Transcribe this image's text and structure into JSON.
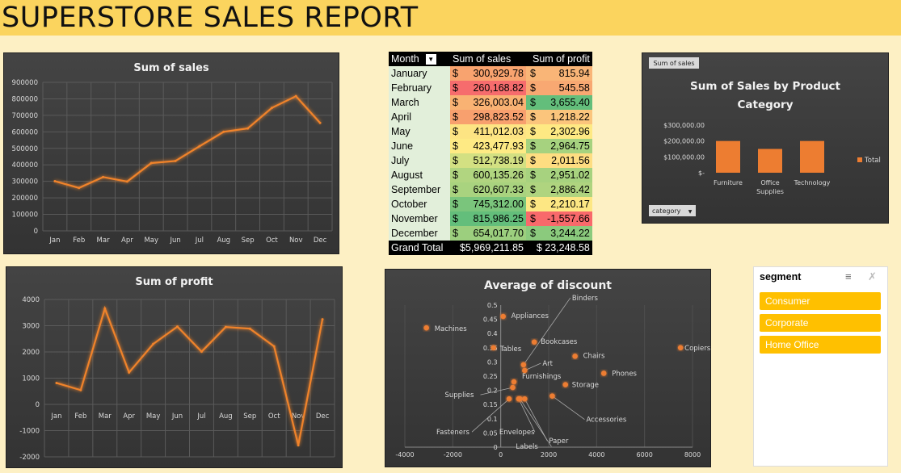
{
  "report_title": "SUPERSTORE SALES REPORT",
  "pivot": {
    "headers": [
      "Month",
      "Sum of sales",
      "Sum of profit"
    ],
    "rows": [
      {
        "month": "January",
        "sales": "300,929.78",
        "profit": "815.94",
        "sales_color": "#f8a36f",
        "profit_color": "#f9b577"
      },
      {
        "month": "February",
        "sales": "260,168.82",
        "profit": "545.58",
        "sales_color": "#f66c6d",
        "profit_color": "#f8a872"
      },
      {
        "month": "March",
        "sales": "326,003.04",
        "profit": "3,655.40",
        "sales_color": "#f9b273",
        "profit_color": "#63be7b"
      },
      {
        "month": "April",
        "sales": "298,823.52",
        "profit": "1,218.22",
        "sales_color": "#f8a06e",
        "profit_color": "#fbc57c"
      },
      {
        "month": "May",
        "sales": "411,012.03",
        "profit": "2,302.96",
        "sales_color": "#fde483",
        "profit_color": "#fee983"
      },
      {
        "month": "June",
        "sales": "423,477.93",
        "profit": "2,964.75",
        "sales_color": "#feea84",
        "profit_color": "#a6d27f"
      },
      {
        "month": "July",
        "sales": "512,738.19",
        "profit": "2,011.56",
        "sales_color": "#d3e082",
        "profit_color": "#fedd81"
      },
      {
        "month": "August",
        "sales": "600,135.26",
        "profit": "2,951.02",
        "sales_color": "#b1d580",
        "profit_color": "#a7d27f"
      },
      {
        "month": "September",
        "sales": "620,607.33",
        "profit": "2,886.42",
        "sales_color": "#a9d37f",
        "profit_color": "#afd47f"
      },
      {
        "month": "October",
        "sales": "745,312.00",
        "profit": "2,210.17",
        "sales_color": "#7ac57c",
        "profit_color": "#fde783"
      },
      {
        "month": "November",
        "sales": "815,986.25",
        "profit": "-1,557.66",
        "sales_color": "#63be7b",
        "profit_color": "#f8696b"
      },
      {
        "month": "December",
        "sales": "654,017.70",
        "profit": "3,244.22",
        "sales_color": "#9ccf7e",
        "profit_color": "#8bca7d"
      }
    ],
    "grand_total": {
      "label": "Grand Total",
      "sales": "$5,969,211.85",
      "profit": "$ 23,248.58"
    },
    "currency": "$"
  },
  "slicer": {
    "title": "segment",
    "items": [
      "Consumer",
      "Corporate",
      "Home Office"
    ],
    "accent": "#ffc000"
  },
  "chart_data": [
    {
      "type": "line",
      "title": "Sum of sales",
      "categories": [
        "Jan",
        "Feb",
        "Mar",
        "Apr",
        "May",
        "Jun",
        "Jul",
        "Aug",
        "Sep",
        "Oct",
        "Nov",
        "Dec"
      ],
      "values": [
        300930,
        260169,
        326003,
        298824,
        411012,
        423478,
        512738,
        600135,
        620607,
        745312,
        815986,
        654018
      ],
      "yticks": [
        "0",
        "100000",
        "200000",
        "300000",
        "400000",
        "500000",
        "600000",
        "700000",
        "800000",
        "900000"
      ],
      "ylim": [
        0,
        900000
      ],
      "grid": true,
      "color": "#f0832b"
    },
    {
      "type": "line",
      "title": "Sum of profit",
      "categories": [
        "Jan",
        "Feb",
        "Mar",
        "Apr",
        "May",
        "Jun",
        "Jul",
        "Aug",
        "Sep",
        "Oct",
        "Nov",
        "Dec"
      ],
      "values": [
        815.94,
        545.58,
        3655.4,
        1218.22,
        2302.96,
        2964.75,
        2011.56,
        2951.02,
        2886.42,
        2210.17,
        -1557.66,
        3244.22
      ],
      "yticks": [
        "-2000",
        "-1000",
        "0",
        "1000",
        "2000",
        "3000",
        "4000"
      ],
      "ylim": [
        -2000,
        4000
      ],
      "grid": true,
      "color": "#f0832b"
    },
    {
      "type": "bar",
      "title": "Sum of Sales by Product Category",
      "field_button": "Sum of sales",
      "axis_button": "category",
      "categories": [
        "Furniture",
        "Office Supplies",
        "Technology"
      ],
      "values": [
        200000,
        150000,
        200000
      ],
      "yticks": [
        "$-",
        "$100,000.00",
        "$200,000.00",
        "$300,000.00"
      ],
      "ylim": [
        0,
        300000
      ],
      "legend": "Total",
      "legend_position": "right",
      "color": "#ed7d31"
    },
    {
      "type": "scatter",
      "title": "Average of discount",
      "xticks": [
        "-4000",
        "-2000",
        "0",
        "2000",
        "4000",
        "6000",
        "8000"
      ],
      "yticks": [
        "0",
        "0.05",
        "0.1",
        "0.15",
        "0.2",
        "0.25",
        "0.3",
        "0.35",
        "0.4",
        "0.45",
        "0.5"
      ],
      "xlim": [
        -4000,
        8000
      ],
      "ylim": [
        0,
        0.5
      ],
      "color": "#ed7d31",
      "points": [
        {
          "label": "Machines",
          "x": -3100,
          "y": 0.42
        },
        {
          "label": "Appliances",
          "x": 100,
          "y": 0.46
        },
        {
          "label": "Binders",
          "x": 950,
          "y": 0.29
        },
        {
          "label": "Tables",
          "x": -300,
          "y": 0.35
        },
        {
          "label": "Bookcases",
          "x": 1400,
          "y": 0.37
        },
        {
          "label": "Chairs",
          "x": 3100,
          "y": 0.32
        },
        {
          "label": "Art",
          "x": 1000,
          "y": 0.27
        },
        {
          "label": "Phones",
          "x": 4300,
          "y": 0.26
        },
        {
          "label": "Copiers",
          "x": 7500,
          "y": 0.35
        },
        {
          "label": "Furnishings",
          "x": 550,
          "y": 0.23
        },
        {
          "label": "Storage",
          "x": 2700,
          "y": 0.22
        },
        {
          "label": "Supplies",
          "x": 500,
          "y": 0.21
        },
        {
          "label": "Accessories",
          "x": 2150,
          "y": 0.18
        },
        {
          "label": "Fasteners",
          "x": 350,
          "y": 0.17
        },
        {
          "label": "Envelopes",
          "x": 750,
          "y": 0.17
        },
        {
          "label": "Labels",
          "x": 800,
          "y": 0.17
        },
        {
          "label": "Paper",
          "x": 1000,
          "y": 0.17
        }
      ]
    }
  ]
}
